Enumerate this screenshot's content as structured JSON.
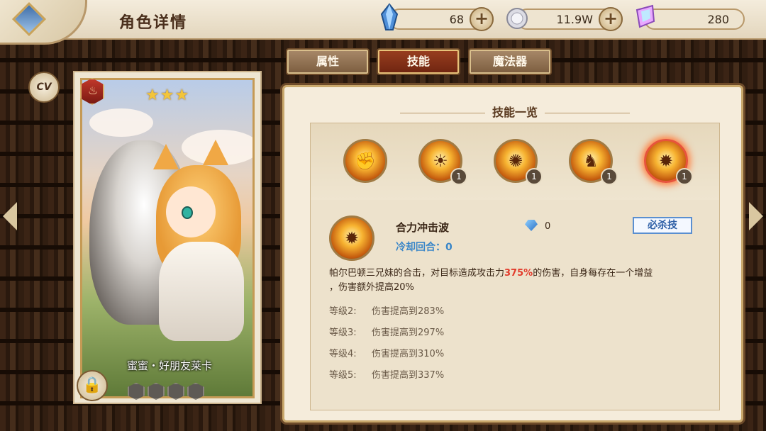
{
  "header": {
    "title": "角色详情",
    "resources": [
      {
        "name": "mana-crystal",
        "value": "68",
        "icon": "blue-crystal-icon"
      },
      {
        "name": "silver-coin",
        "value": "11.9W",
        "icon": "silver-coin-icon"
      },
      {
        "name": "rainbow-gem",
        "value": "280",
        "icon": "rainbow-gem-icon"
      }
    ]
  },
  "tabs": [
    {
      "label": "属性",
      "active": false
    },
    {
      "label": "技能",
      "active": true
    },
    {
      "label": "魔法器",
      "active": false
    }
  ],
  "card": {
    "name": "蜜蜜・好朋友莱卡",
    "stars": "★★★",
    "element_glyph": "♨",
    "cv_label": "CV"
  },
  "skills_panel": {
    "title": "技能一览",
    "skills": [
      {
        "icon": "fist-strike-icon",
        "glyph": "✊",
        "level": ""
      },
      {
        "icon": "golden-bell-icon",
        "glyph": "☀",
        "level": "1"
      },
      {
        "icon": "golden-spiral-icon",
        "glyph": "✺",
        "level": "1"
      },
      {
        "icon": "summon-beast-icon",
        "glyph": "♞",
        "level": "1"
      },
      {
        "icon": "shockwave-icon",
        "glyph": "✹",
        "level": "1"
      }
    ],
    "selected": {
      "name": "合力冲击波",
      "cost": "0",
      "tag": "必杀技",
      "cooldown": "冷却回合：0",
      "desc_part1": "帕尔巴顿三兄妹的合击，对目标造成攻击力",
      "desc_highlight": "375%",
      "desc_part2": "的伤害，自身每存在一个增益",
      "desc_line2": "，伤害额外提高20%",
      "levels": [
        {
          "label": "等级2:",
          "text": "伤害提高到283%"
        },
        {
          "label": "等级3:",
          "text": "伤害提高到297%"
        },
        {
          "label": "等级4:",
          "text": "伤害提高到310%"
        },
        {
          "label": "等级5:",
          "text": "伤害提高到337%"
        }
      ]
    }
  },
  "colors": {
    "accent_red": "#e23b2b",
    "cooldown_blue": "#3a86c8",
    "ult_blue": "#2d5fa6"
  }
}
